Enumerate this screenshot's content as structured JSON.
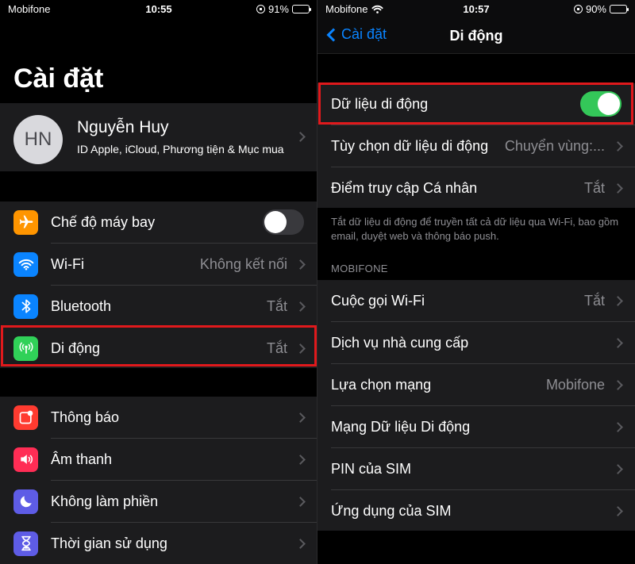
{
  "left": {
    "status": {
      "carrier": "Mobifone",
      "time": "10:55",
      "battery": "91%"
    },
    "title": "Cài đặt",
    "profile": {
      "initials": "HN",
      "name": "Nguyễn Huy",
      "subtitle": "ID Apple, iCloud, Phương tiện & Mục mua"
    },
    "group1": [
      {
        "label": "Chế độ máy bay",
        "icon": "airplane-icon",
        "color": "#ff9500",
        "toggle": "off"
      },
      {
        "label": "Wi-Fi",
        "icon": "wifi-icon",
        "color": "#0a84ff",
        "value": "Không kết nối"
      },
      {
        "label": "Bluetooth",
        "icon": "bluetooth-icon",
        "color": "#0a84ff",
        "value": "Tắt"
      },
      {
        "label": "Di động",
        "icon": "antenna-icon",
        "color": "#30d158",
        "value": "Tắt"
      }
    ],
    "group2": [
      {
        "label": "Thông báo",
        "icon": "notification-icon",
        "color": "#ff3b30"
      },
      {
        "label": "Âm thanh",
        "icon": "speaker-icon",
        "color": "#ff2d55"
      },
      {
        "label": "Không làm phiền",
        "icon": "moon-icon",
        "color": "#5e5ce6"
      },
      {
        "label": "Thời gian sử dụng",
        "icon": "hourglass-icon",
        "color": "#5e5ce6"
      }
    ]
  },
  "right": {
    "status": {
      "carrier": "Mobifone",
      "time": "10:57",
      "battery": "90%"
    },
    "nav": {
      "back": "Cài đặt",
      "title": "Di động"
    },
    "group1": [
      {
        "label": "Dữ liệu di động",
        "toggle": "on"
      },
      {
        "label": "Tùy chọn dữ liệu di động",
        "value": "Chuyển vùng:..."
      },
      {
        "label": "Điểm truy cập Cá nhân",
        "value": "Tắt"
      }
    ],
    "footnote": "Tắt dữ liệu di động để truyền tất cả dữ liệu qua Wi-Fi, bao gồm email, duyệt web và thông báo push.",
    "section": "MOBIFONE",
    "group2": [
      {
        "label": "Cuộc gọi Wi-Fi",
        "value": "Tắt"
      },
      {
        "label": "Dịch vụ nhà cung cấp"
      },
      {
        "label": "Lựa chọn mạng",
        "value": "Mobifone"
      },
      {
        "label": "Mạng Dữ liệu Di động"
      },
      {
        "label": "PIN của SIM"
      },
      {
        "label": "Ứng dụng của SIM"
      }
    ]
  },
  "colors": {
    "accent": "#0a84ff",
    "highlight": "#e0191c",
    "toggle_on": "#34c759"
  }
}
